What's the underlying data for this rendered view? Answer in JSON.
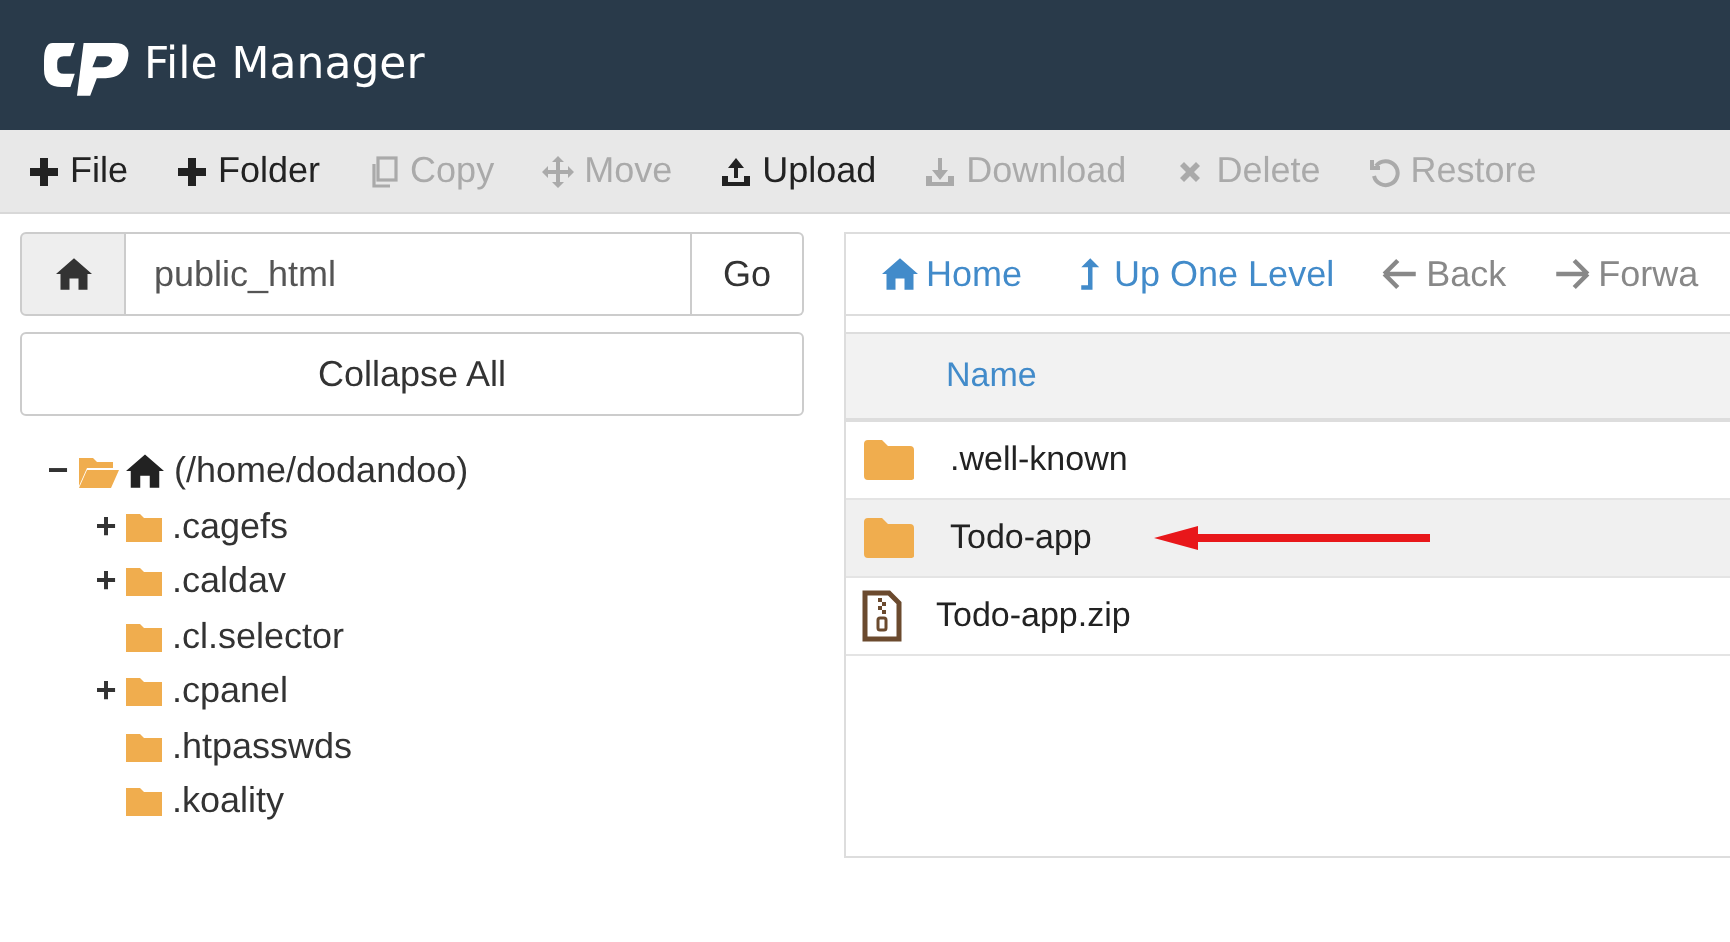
{
  "header": {
    "title": "File Manager"
  },
  "toolbar": [
    {
      "kind": "plus",
      "label": "File",
      "disabled": false
    },
    {
      "kind": "plus",
      "label": "Folder",
      "disabled": false
    },
    {
      "kind": "copy",
      "label": "Copy",
      "disabled": true
    },
    {
      "kind": "move",
      "label": "Move",
      "disabled": true
    },
    {
      "kind": "upload",
      "label": "Upload",
      "disabled": false
    },
    {
      "kind": "download",
      "label": "Download",
      "disabled": true
    },
    {
      "kind": "delete",
      "label": "Delete",
      "disabled": true
    },
    {
      "kind": "restore",
      "label": "Restore",
      "disabled": true
    }
  ],
  "path_bar": {
    "value": "public_html",
    "go": "Go"
  },
  "collapse_button": "Collapse All",
  "tree": [
    {
      "label": "(/home/dodandoo)",
      "toggle": "−",
      "expanded": true,
      "home": true,
      "children": [
        {
          "label": ".cagefs",
          "toggle": "+",
          "expanded": false
        },
        {
          "label": ".caldav",
          "toggle": "+",
          "expanded": false
        },
        {
          "label": ".cl.selector",
          "expanded": false
        },
        {
          "label": ".cpanel",
          "toggle": "+",
          "expanded": false
        },
        {
          "label": ".htpasswds",
          "expanded": false
        },
        {
          "label": ".koality",
          "expanded": false
        }
      ]
    }
  ],
  "nav": [
    {
      "kind": "home",
      "label": "Home",
      "disabled": false
    },
    {
      "kind": "up",
      "label": "Up One Level",
      "disabled": false
    },
    {
      "kind": "back",
      "label": "Back",
      "disabled": true
    },
    {
      "kind": "forward",
      "label": "Forwa",
      "disabled": true
    }
  ],
  "table": {
    "columns": [
      "Name"
    ],
    "rows": [
      {
        "kind": "folder",
        "name": ".well-known",
        "selected": false,
        "pointed": false
      },
      {
        "kind": "folder",
        "name": "Todo-app",
        "selected": true,
        "pointed": true
      },
      {
        "kind": "zip",
        "name": "Todo-app.zip",
        "selected": false,
        "pointed": false
      }
    ]
  }
}
